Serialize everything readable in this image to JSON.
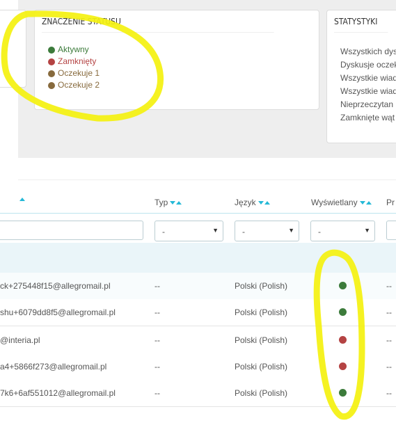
{
  "colors": {
    "aktywny": "#3c7b3b",
    "zamkniety": "#b44343",
    "oczekuje": "#876a3d",
    "accent": "#25b9d7",
    "highlight": "#f4f10f"
  },
  "status_panel": {
    "title": "ZNACZENIE STATUSU",
    "items": [
      {
        "label": "Aktywny",
        "color": "#3c7b3b"
      },
      {
        "label": "Zamknięty",
        "color": "#b44343"
      },
      {
        "label": "Oczekuje 1",
        "color": "#876a3d"
      },
      {
        "label": "Oczekuje 2",
        "color": "#876a3d"
      }
    ]
  },
  "stats_panel": {
    "title": "STATYSTYKI",
    "items": [
      "Wszystkich dys",
      "Dyskusje oczek",
      "Wszystkie wiad",
      "Wszystkie wiad",
      "Nieprzeczytan",
      "Zamknięte wąt"
    ]
  },
  "table": {
    "headers": {
      "typ": "Typ",
      "jezyk": "Język",
      "wyswietlany": "Wyświetlany",
      "partial": "Pr"
    },
    "filters": {
      "typ": "-",
      "jezyk": "-",
      "wyswietlany": "-"
    },
    "rows": [
      {
        "email": "ck+275448f15@allegromail.pl",
        "type": "--",
        "language": "Polski (Polish)",
        "status": "aktywny",
        "status_color": "#3c7b3b",
        "extra": "--"
      },
      {
        "email": "shu+6079dd8f5@allegromail.pl",
        "type": "--",
        "language": "Polski (Polish)",
        "status": "aktywny",
        "status_color": "#3c7b3b",
        "extra": "--"
      },
      {
        "email": "@interia.pl",
        "type": "--",
        "language": "Polski (Polish)",
        "status": "zamkniety",
        "status_color": "#b44343",
        "extra": "--"
      },
      {
        "email": "a4+5866f273@allegromail.pl",
        "type": "--",
        "language": "Polski (Polish)",
        "status": "zamkniety",
        "status_color": "#b44343",
        "extra": "--"
      },
      {
        "email": "7k6+6af551012@allegromail.pl",
        "type": "--",
        "language": "Polski (Polish)",
        "status": "aktywny",
        "status_color": "#3c7b3b",
        "extra": "--"
      }
    ]
  }
}
